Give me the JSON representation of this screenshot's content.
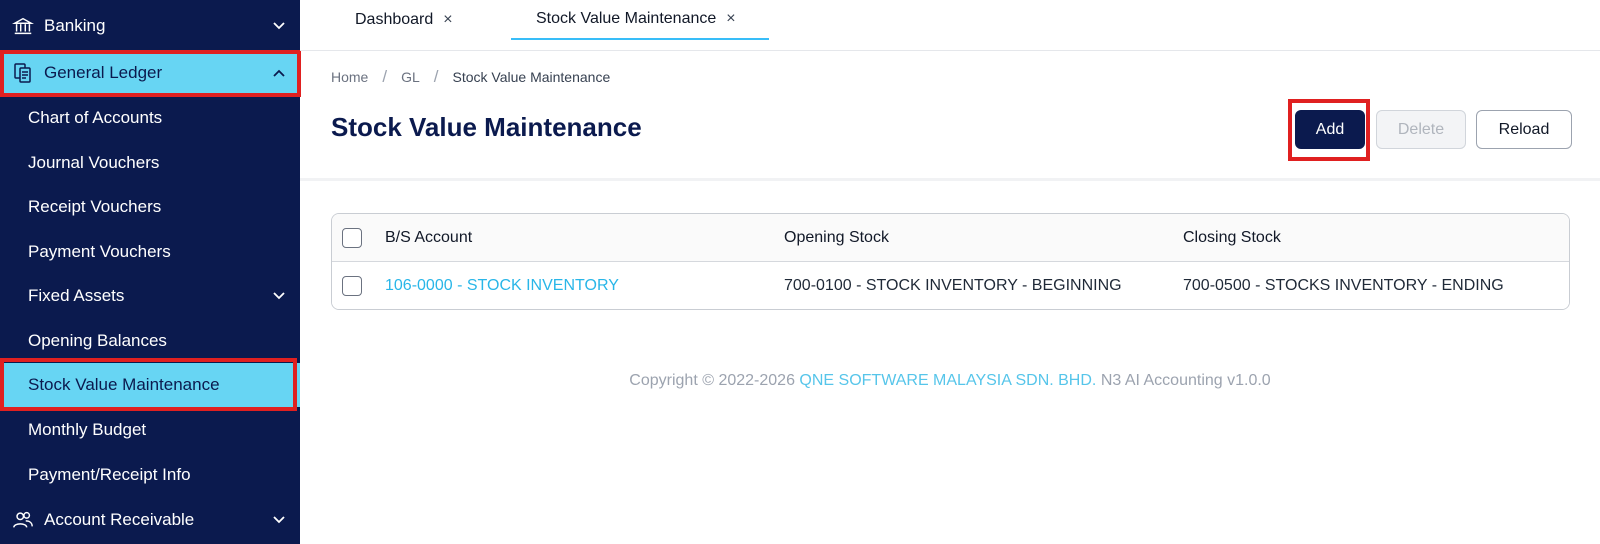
{
  "sidebar": {
    "items": [
      {
        "label": "Banking",
        "icon": "bank-icon",
        "chevron": "down"
      },
      {
        "label": "General Ledger",
        "icon": "ledger-icon",
        "chevron": "up",
        "active": true
      },
      {
        "label": "Chart of Accounts"
      },
      {
        "label": "Journal Vouchers"
      },
      {
        "label": "Receipt Vouchers"
      },
      {
        "label": "Payment Vouchers"
      },
      {
        "label": "Fixed Assets",
        "chevron": "down"
      },
      {
        "label": "Opening Balances"
      },
      {
        "label": "Stock Value Maintenance",
        "active": true
      },
      {
        "label": "Monthly Budget"
      },
      {
        "label": "Payment/Receipt Info"
      },
      {
        "label": "Account Receivable",
        "icon": "users-icon",
        "chevron": "down"
      }
    ]
  },
  "tabs": [
    {
      "label": "Dashboard",
      "close": "×"
    },
    {
      "label": "Stock Value Maintenance",
      "close": "×",
      "active": true
    }
  ],
  "breadcrumb": {
    "items": [
      "Home",
      "GL",
      "Stock Value Maintenance"
    ],
    "separator": "/"
  },
  "page": {
    "title": "Stock Value Maintenance"
  },
  "toolbar": {
    "add_label": "Add",
    "delete_label": "Delete",
    "reload_label": "Reload"
  },
  "table": {
    "headers": [
      "B/S Account",
      "Opening Stock",
      "Closing Stock"
    ],
    "rows": [
      [
        "106-0000 - STOCK INVENTORY",
        "700-0100 - STOCK INVENTORY - BEGINNING",
        "700-0500 - STOCKS INVENTORY - ENDING"
      ]
    ]
  },
  "footer": {
    "prefix": "Copyright © 2022-2026",
    "company": "QNE SOFTWARE MALAYSIA SDN. BHD.",
    "suffix": "N3 AI Accounting v1.0.0"
  },
  "colors": {
    "sidebar_bg": "#0b1a4e",
    "active_bg": "#67d5f3",
    "highlight": "#e02020",
    "link": "#29b6e8",
    "primary_button": "#0b1a4e"
  }
}
